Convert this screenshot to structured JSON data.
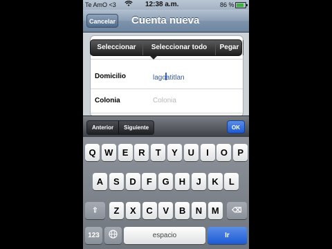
{
  "status": {
    "carrier": "Te AmO <3",
    "time": "12:38 a.m.",
    "battery": "86 %",
    "battery_level": 0.86,
    "wifi_icon": "wifi-icon"
  },
  "navbar": {
    "cancel": "Cancelar",
    "title": "Cuenta nueva"
  },
  "edit_menu": [
    "Seleccionar",
    "Seleccionar todo",
    "Pegar"
  ],
  "form": {
    "rows": [
      {
        "label": "Domicilio",
        "value_before": "lago",
        "value_after": "atitlan"
      },
      {
        "label": "Colonia",
        "placeholder": "Colonia"
      }
    ]
  },
  "toolbar": {
    "prev": "Anterior",
    "next": "Siguiente",
    "ok": "OK"
  },
  "keyboard": {
    "row1": [
      "Q",
      "W",
      "E",
      "R",
      "T",
      "Y",
      "U",
      "I",
      "O",
      "P"
    ],
    "row2": [
      "A",
      "S",
      "D",
      "F",
      "G",
      "H",
      "J",
      "K",
      "L"
    ],
    "row3": [
      "Z",
      "X",
      "C",
      "V",
      "B",
      "N",
      "M"
    ],
    "numbers": "123",
    "space": "espacio",
    "go": "Ir"
  }
}
